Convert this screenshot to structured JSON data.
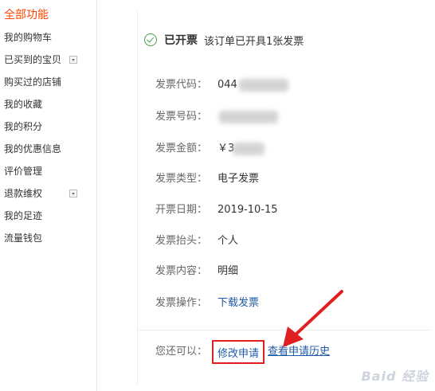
{
  "sidebar": {
    "title": "全部功能",
    "items": [
      {
        "label": "我的购物车",
        "expandable": false
      },
      {
        "label": "已买到的宝贝",
        "expandable": true
      },
      {
        "label": "购买过的店铺",
        "expandable": false
      },
      {
        "label": "我的收藏",
        "expandable": false
      },
      {
        "label": "我的积分",
        "expandable": false
      },
      {
        "label": "我的优惠信息",
        "expandable": false
      },
      {
        "label": "评价管理",
        "expandable": false
      },
      {
        "label": "退款维权",
        "expandable": true
      },
      {
        "label": "我的足迹",
        "expandable": false
      },
      {
        "label": "流量钱包",
        "expandable": false
      }
    ]
  },
  "status": {
    "main": "已开票",
    "sub": "该订单已开具1张发票"
  },
  "fields": {
    "code_label": "发票代码：",
    "code_value": "044",
    "number_label": "发票号码：",
    "number_value": "",
    "amount_label": "发票金额：",
    "amount_value": "￥3",
    "type_label": "发票类型：",
    "type_value": "电子发票",
    "date_label": "开票日期：",
    "date_value": "2019-10-15",
    "header_label": "发票抬头：",
    "header_value": "个人",
    "content_label": "发票内容：",
    "content_value": "明细",
    "action_label": "发票操作：",
    "action_link": "下载发票"
  },
  "footer": {
    "also_label": "您还可以：",
    "edit_link": "修改申请",
    "history_link": "查看申请历史"
  },
  "colors": {
    "accent": "#ff4400",
    "link": "#1f5aa8",
    "highlight": "#e02020",
    "success": "#4aa04a"
  }
}
